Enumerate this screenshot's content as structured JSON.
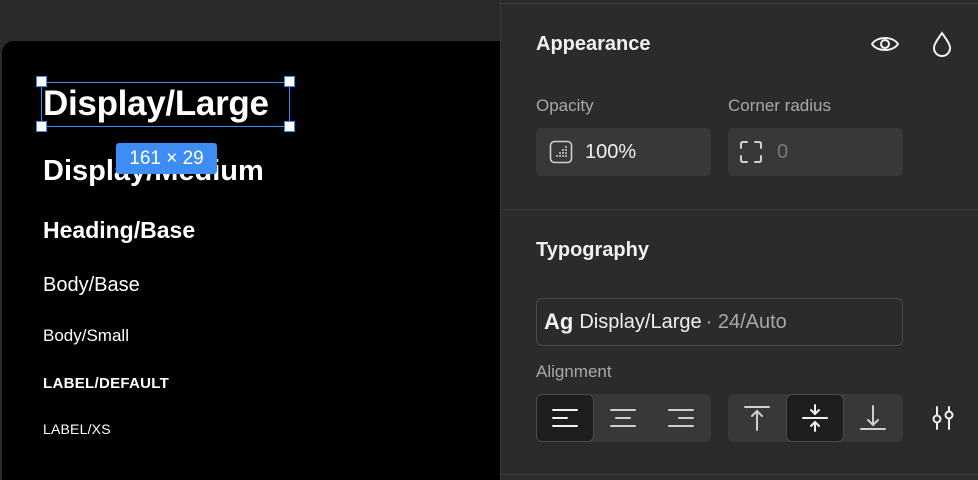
{
  "canvas": {
    "styles": [
      {
        "label": "Display/Large"
      },
      {
        "label": "Display/Medium"
      },
      {
        "label": "Heading/Base"
      },
      {
        "label": "Body/Base"
      },
      {
        "label": "Body/Small"
      },
      {
        "label": "LABEL/DEFAULT"
      },
      {
        "label": "LABEL/XS"
      }
    ],
    "selection_size": "161 × 29"
  },
  "appearance": {
    "title": "Appearance",
    "opacity_label": "Opacity",
    "opacity_value": "100%",
    "corner_radius_label": "Corner radius",
    "corner_radius_value": "0"
  },
  "typography": {
    "title": "Typography",
    "preview_glyph": "Ag",
    "style_name": "Display/Large",
    "style_meta": "· 24/Auto",
    "alignment_label": "Alignment",
    "horizontal_selected": "left",
    "vertical_selected": "middle"
  },
  "colors": {
    "accent": "#3d8df5",
    "panel_bg": "#2b2b2b",
    "field_bg": "#383838",
    "artboard_bg": "#000000"
  }
}
